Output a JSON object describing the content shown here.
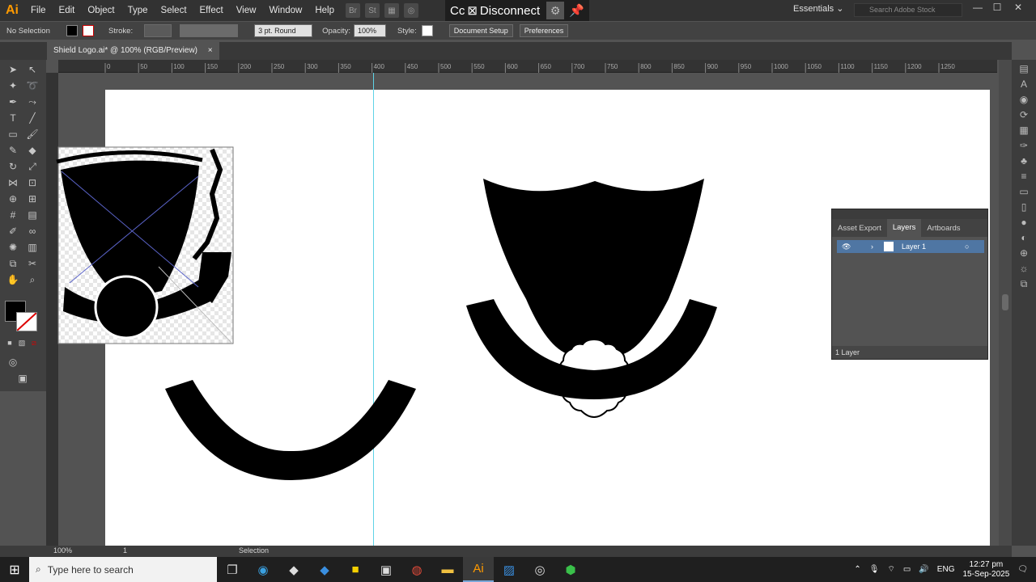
{
  "menubar": {
    "logo": "Ai",
    "items": [
      "File",
      "Edit",
      "Object",
      "Type",
      "Select",
      "Effect",
      "View",
      "Window",
      "Help"
    ],
    "bridge": "Br",
    "stock": "St",
    "cc_label": "Cc",
    "disconnect": "Disconnect",
    "workspace": "Essentials",
    "search_placeholder": "Search Adobe Stock"
  },
  "control": {
    "selection": "No Selection",
    "stroke_label": "Stroke:",
    "brush": "3 pt. Round",
    "opacity_label": "Opacity:",
    "opacity": "100%",
    "style_label": "Style:",
    "doc_setup": "Document Setup",
    "preferences": "Preferences"
  },
  "tab": {
    "title": "Shield Logo.ai* @ 100% (RGB/Preview)",
    "close": "×"
  },
  "ruler": [
    "0",
    "50",
    "100",
    "150",
    "200",
    "250",
    "300",
    "350",
    "400",
    "450",
    "500",
    "550",
    "600",
    "650",
    "700",
    "750",
    "800",
    "850",
    "900",
    "950",
    "1000",
    "1050",
    "1100",
    "1150",
    "1200",
    "1250"
  ],
  "status": {
    "zoom": "100%",
    "artboard": "1",
    "mode": "Selection"
  },
  "layers_panel": {
    "tabs": [
      "Asset Export",
      "Layers",
      "Artboards"
    ],
    "layer_name": "Layer 1",
    "count": "1 Layer"
  },
  "taskbar": {
    "search": "Type here to search",
    "lang": "ENG",
    "time": "12:27 pm",
    "date": "15-Sep-2025"
  },
  "colors": {
    "accent": "#4f76a3",
    "guide": "#5fd3e6",
    "cc_bg": "#1e1e1e"
  }
}
